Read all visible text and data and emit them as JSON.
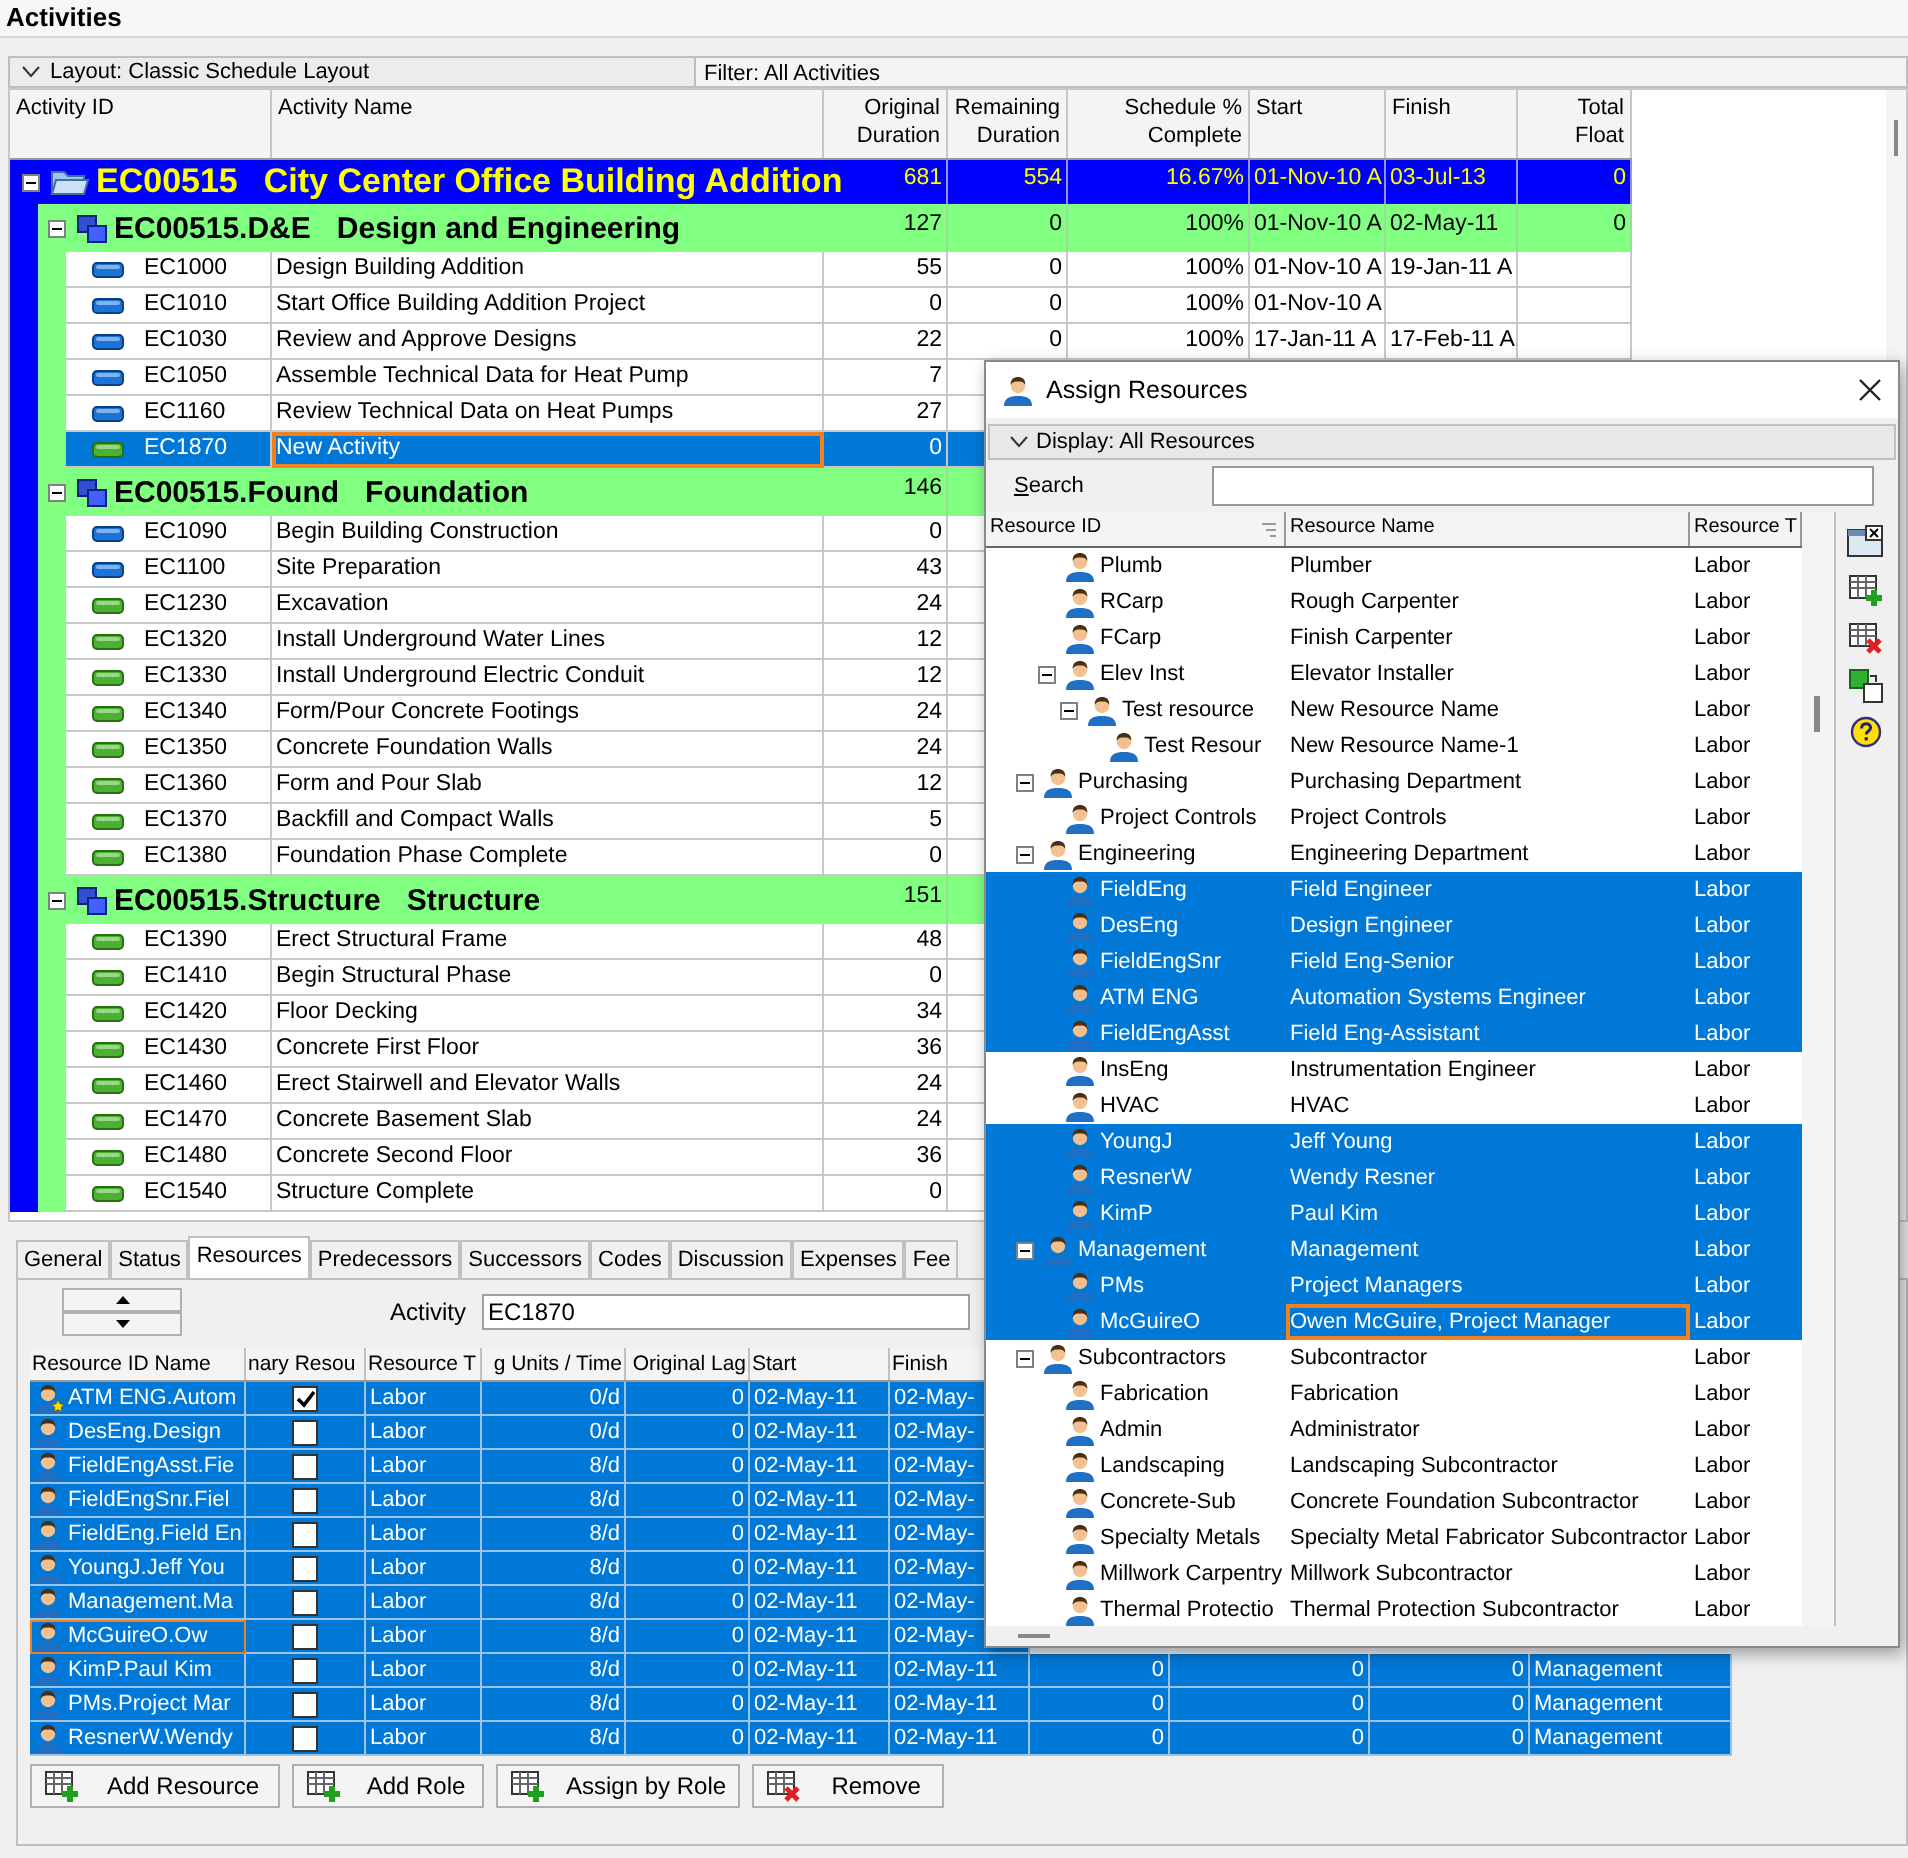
{
  "page_title": "Activities",
  "layout_bar": {
    "layout": "Layout: Classic Schedule Layout",
    "filter": "Filter: All Activities"
  },
  "activities": {
    "columns": [
      "Activity ID",
      "Activity Name",
      "Original Duration",
      "Remaining Duration",
      "Schedule % Complete",
      "Start",
      "Finish",
      "Total Float"
    ],
    "rows": [
      {
        "kind": "project",
        "expanded": true,
        "cells": [
          "EC00515",
          "City Center Office Building Addition",
          "681",
          "554",
          "16.67%",
          "01-Nov-10 A",
          "03-Jul-13",
          "0"
        ]
      },
      {
        "kind": "wbs",
        "expanded": true,
        "cells": [
          "EC00515.D&E",
          "Design and Engineering",
          "127",
          "0",
          "100%",
          "01-Nov-10 A",
          "02-May-11",
          "0"
        ]
      },
      {
        "kind": "activity",
        "completed": true,
        "selected": false,
        "cells": [
          "EC1000",
          "Design Building Addition",
          "55",
          "0",
          "100%",
          "01-Nov-10 A",
          "19-Jan-11 A"
        ]
      },
      {
        "kind": "activity",
        "completed": true,
        "selected": false,
        "cells": [
          "EC1010",
          "Start Office Building Addition Project",
          "0",
          "0",
          "100%",
          "01-Nov-10 A"
        ]
      },
      {
        "kind": "activity",
        "completed": true,
        "selected": false,
        "cells": [
          "EC1030",
          "Review and Approve Designs",
          "22",
          "0",
          "100%",
          "17-Jan-11 A",
          "17-Feb-11 A"
        ]
      },
      {
        "kind": "activity",
        "completed": true,
        "selected": false,
        "cells": [
          "EC1050",
          "Assemble Technical Data for Heat Pump",
          "7"
        ]
      },
      {
        "kind": "activity",
        "completed": true,
        "selected": false,
        "cells": [
          "EC1160",
          "Review Technical Data on Heat Pumps",
          "27"
        ]
      },
      {
        "kind": "activity",
        "completed": false,
        "selected": true,
        "focused": true,
        "cells": [
          "EC1870",
          "New Activity",
          "0"
        ]
      },
      {
        "kind": "wbs",
        "expanded": true,
        "cells": [
          "EC00515.Found",
          "Foundation",
          "146"
        ]
      },
      {
        "kind": "activity",
        "completed": true,
        "selected": false,
        "cells": [
          "EC1090",
          "Begin Building Construction",
          "0"
        ]
      },
      {
        "kind": "activity",
        "completed": true,
        "selected": false,
        "cells": [
          "EC1100",
          "Site Preparation",
          "43"
        ]
      },
      {
        "kind": "activity",
        "completed": false,
        "selected": false,
        "cells": [
          "EC1230",
          "Excavation",
          "24"
        ]
      },
      {
        "kind": "activity",
        "completed": false,
        "selected": false,
        "cells": [
          "EC1320",
          "Install Underground Water Lines",
          "12"
        ]
      },
      {
        "kind": "activity",
        "completed": false,
        "selected": false,
        "cells": [
          "EC1330",
          "Install Underground Electric Conduit",
          "12"
        ]
      },
      {
        "kind": "activity",
        "completed": false,
        "selected": false,
        "cells": [
          "EC1340",
          "Form/Pour Concrete Footings",
          "24"
        ]
      },
      {
        "kind": "activity",
        "completed": false,
        "selected": false,
        "cells": [
          "EC1350",
          "Concrete Foundation Walls",
          "24"
        ]
      },
      {
        "kind": "activity",
        "completed": false,
        "selected": false,
        "cells": [
          "EC1360",
          "Form and Pour Slab",
          "12"
        ]
      },
      {
        "kind": "activity",
        "completed": false,
        "selected": false,
        "cells": [
          "EC1370",
          "Backfill and Compact Walls",
          "5"
        ]
      },
      {
        "kind": "activity",
        "completed": false,
        "selected": false,
        "cells": [
          "EC1380",
          "Foundation Phase Complete",
          "0"
        ]
      },
      {
        "kind": "wbs",
        "expanded": true,
        "cells": [
          "EC00515.Structure",
          "Structure",
          "151"
        ]
      },
      {
        "kind": "activity",
        "completed": false,
        "selected": false,
        "cells": [
          "EC1390",
          "Erect Structural Frame",
          "48"
        ]
      },
      {
        "kind": "activity",
        "completed": false,
        "selected": false,
        "cells": [
          "EC1410",
          "Begin Structural Phase",
          "0"
        ]
      },
      {
        "kind": "activity",
        "completed": false,
        "selected": false,
        "cells": [
          "EC1420",
          "Floor Decking",
          "34"
        ]
      },
      {
        "kind": "activity",
        "completed": false,
        "selected": false,
        "cells": [
          "EC1430",
          "Concrete First Floor",
          "36"
        ]
      },
      {
        "kind": "activity",
        "completed": false,
        "selected": false,
        "cells": [
          "EC1460",
          "Erect Stairwell and Elevator Walls",
          "24"
        ]
      },
      {
        "kind": "activity",
        "completed": false,
        "selected": false,
        "cells": [
          "EC1470",
          "Concrete Basement Slab",
          "24"
        ]
      },
      {
        "kind": "activity",
        "completed": false,
        "selected": false,
        "cells": [
          "EC1480",
          "Concrete Second Floor",
          "36"
        ]
      },
      {
        "kind": "activity",
        "completed": false,
        "selected": false,
        "cells": [
          "EC1540",
          "Structure Complete",
          "0"
        ]
      }
    ]
  },
  "details": {
    "tabs": [
      {
        "label": "General",
        "selected": false
      },
      {
        "label": "Status",
        "selected": false
      },
      {
        "label": "Resources",
        "selected": true
      },
      {
        "label": "Predecessors",
        "selected": false
      },
      {
        "label": "Successors",
        "selected": false
      },
      {
        "label": "Codes",
        "selected": false
      },
      {
        "label": "Discussion",
        "selected": false
      },
      {
        "label": "Expenses",
        "selected": false
      },
      {
        "label": "Fee",
        "selected": false
      }
    ],
    "activity_label": "Activity",
    "activity_value": "EC1870",
    "columns": [
      "Resource ID Name",
      "nary Resou",
      "Resource T",
      "g Units / Time",
      "Original Lag",
      "Start",
      "Finish"
    ],
    "rows": [
      {
        "primary": true,
        "selected": true,
        "cells": [
          "ATM ENG.Autom",
          "",
          "Labor",
          "0/d",
          "0",
          "02-May-11",
          "02-May-"
        ]
      },
      {
        "primary": false,
        "selected": true,
        "cells": [
          "DesEng.Design",
          "",
          "Labor",
          "0/d",
          "0",
          "02-May-11",
          "02-May-"
        ]
      },
      {
        "primary": false,
        "selected": true,
        "cells": [
          "FieldEngAsst.Fie",
          "",
          "Labor",
          "8/d",
          "0",
          "02-May-11",
          "02-May-"
        ]
      },
      {
        "primary": false,
        "selected": true,
        "cells": [
          "FieldEngSnr.Fiel",
          "",
          "Labor",
          "8/d",
          "0",
          "02-May-11",
          "02-May-"
        ]
      },
      {
        "primary": false,
        "selected": true,
        "cells": [
          "FieldEng.Field En",
          "",
          "Labor",
          "8/d",
          "0",
          "02-May-11",
          "02-May-"
        ]
      },
      {
        "primary": false,
        "selected": true,
        "cells": [
          "YoungJ.Jeff You",
          "",
          "Labor",
          "8/d",
          "0",
          "02-May-11",
          "02-May-"
        ]
      },
      {
        "primary": false,
        "selected": true,
        "cells": [
          "Management.Ma",
          "",
          "Labor",
          "8/d",
          "0",
          "02-May-11",
          "02-May-"
        ]
      },
      {
        "primary": false,
        "selected": true,
        "focused": true,
        "cells": [
          "McGuireO.Ow",
          "",
          "Labor",
          "8/d",
          "0",
          "02-May-11",
          "02-May-"
        ]
      },
      {
        "primary": false,
        "selected": true,
        "cells": [
          "KimP.Paul Kim",
          "",
          "Labor",
          "8/d",
          "0",
          "02-May-11",
          "02-May-11",
          "0",
          "0",
          "0",
          "Management"
        ]
      },
      {
        "primary": false,
        "selected": true,
        "cells": [
          "PMs.Project Mar",
          "",
          "Labor",
          "8/d",
          "0",
          "02-May-11",
          "02-May-11",
          "0",
          "0",
          "0",
          "Management"
        ]
      },
      {
        "primary": false,
        "selected": true,
        "cells": [
          "ResnerW.Wendy",
          "",
          "Labor",
          "8/d",
          "0",
          "02-May-11",
          "02-May-11",
          "0",
          "0",
          "0",
          "Management"
        ]
      }
    ],
    "buttons": [
      "Add Resource",
      "Add Role",
      "Assign by Role",
      "Remove"
    ]
  },
  "assign_resources": {
    "title": "Assign Resources",
    "display": "Display: All Resources",
    "search_label": "Search",
    "columns": [
      "Resource ID",
      "Resource Name",
      "Resource T"
    ],
    "tree": [
      {
        "children": [
          {
            "id": "Plumb",
            "name": "Plumber",
            "type": "Labor",
            "selected": false
          },
          {
            "id": "RCarp",
            "name": "Rough Carpenter",
            "type": "Labor",
            "selected": false
          },
          {
            "id": "FCarp",
            "name": "Finish Carpenter",
            "type": "Labor",
            "selected": false
          },
          {
            "id": "Elev Inst",
            "name": "Elevator Installer",
            "type": "Labor",
            "selected": false,
            "expanded": true,
            "children": [
              {
                "id": "Test resource",
                "name": "New Resource Name",
                "type": "Labor",
                "selected": false,
                "expanded": true,
                "children": [
                  {
                    "id": "Test Resour",
                    "name": "New Resource Name-1",
                    "type": "Labor",
                    "selected": false
                  }
                ]
              }
            ]
          }
        ]
      },
      {
        "id": "Purchasing",
        "name": "Purchasing Department",
        "type": "Labor",
        "selected": false,
        "expanded": true,
        "children": [
          {
            "id": "Project Controls",
            "name": "Project Controls",
            "type": "Labor",
            "selected": false
          }
        ]
      },
      {
        "id": "Engineering",
        "name": "Engineering Department",
        "type": "Labor",
        "selected": false,
        "expanded": true,
        "children": [
          {
            "id": "FieldEng",
            "name": "Field Engineer",
            "type": "Labor",
            "selected": true
          },
          {
            "id": "DesEng",
            "name": "Design Engineer",
            "type": "Labor",
            "selected": true
          },
          {
            "id": "FieldEngSnr",
            "name": "Field Eng-Senior",
            "type": "Labor",
            "selected": true
          },
          {
            "id": "ATM ENG",
            "name": "Automation Systems Engineer",
            "type": "Labor",
            "selected": true
          },
          {
            "id": "FieldEngAsst",
            "name": "Field Eng-Assistant",
            "type": "Labor",
            "selected": true
          },
          {
            "id": "InsEng",
            "name": "Instrumentation Engineer",
            "type": "Labor",
            "selected": false
          },
          {
            "id": "HVAC",
            "name": "HVAC",
            "type": "Labor",
            "selected": false
          },
          {
            "id": "YoungJ",
            "name": "Jeff Young",
            "type": "Labor",
            "selected": true
          },
          {
            "id": "ResnerW",
            "name": "Wendy Resner",
            "type": "Labor",
            "selected": true
          },
          {
            "id": "KimP",
            "name": "Paul Kim",
            "type": "Labor",
            "selected": true
          }
        ]
      },
      {
        "id": "Management",
        "name": "Management",
        "type": "Labor",
        "selected": true,
        "expanded": true,
        "children": [
          {
            "id": "PMs",
            "name": "Project Managers",
            "type": "Labor",
            "selected": true
          },
          {
            "id": "McGuireO",
            "name": "Owen McGuire, Project Manager",
            "type": "Labor",
            "selected": true,
            "focused": true
          }
        ]
      },
      {
        "id": "Subcontractors",
        "name": "Subcontractor",
        "type": "Labor",
        "selected": false,
        "expanded": true,
        "children": [
          {
            "id": "Fabrication",
            "name": "Fabrication",
            "type": "Labor",
            "selected": false
          },
          {
            "id": "Admin",
            "name": "Administrator",
            "type": "Labor",
            "selected": false
          },
          {
            "id": "Landscaping",
            "name": "Landscaping Subcontractor",
            "type": "Labor",
            "selected": false
          },
          {
            "id": "Concrete-Sub",
            "name": "Concrete Foundation Subcontractor",
            "type": "Labor",
            "selected": false
          },
          {
            "id": "Specialty Metals",
            "name": "Specialty Metal Fabricator Subcontractor",
            "type": "Labor",
            "selected": false
          },
          {
            "id": "Millwork Carpentry",
            "name": "Millwork Subcontractor",
            "type": "Labor",
            "selected": false
          },
          {
            "id": "Thermal Protectio",
            "name": "Thermal Protection Subcontractor",
            "type": "Labor",
            "selected": false
          }
        ]
      }
    ]
  }
}
